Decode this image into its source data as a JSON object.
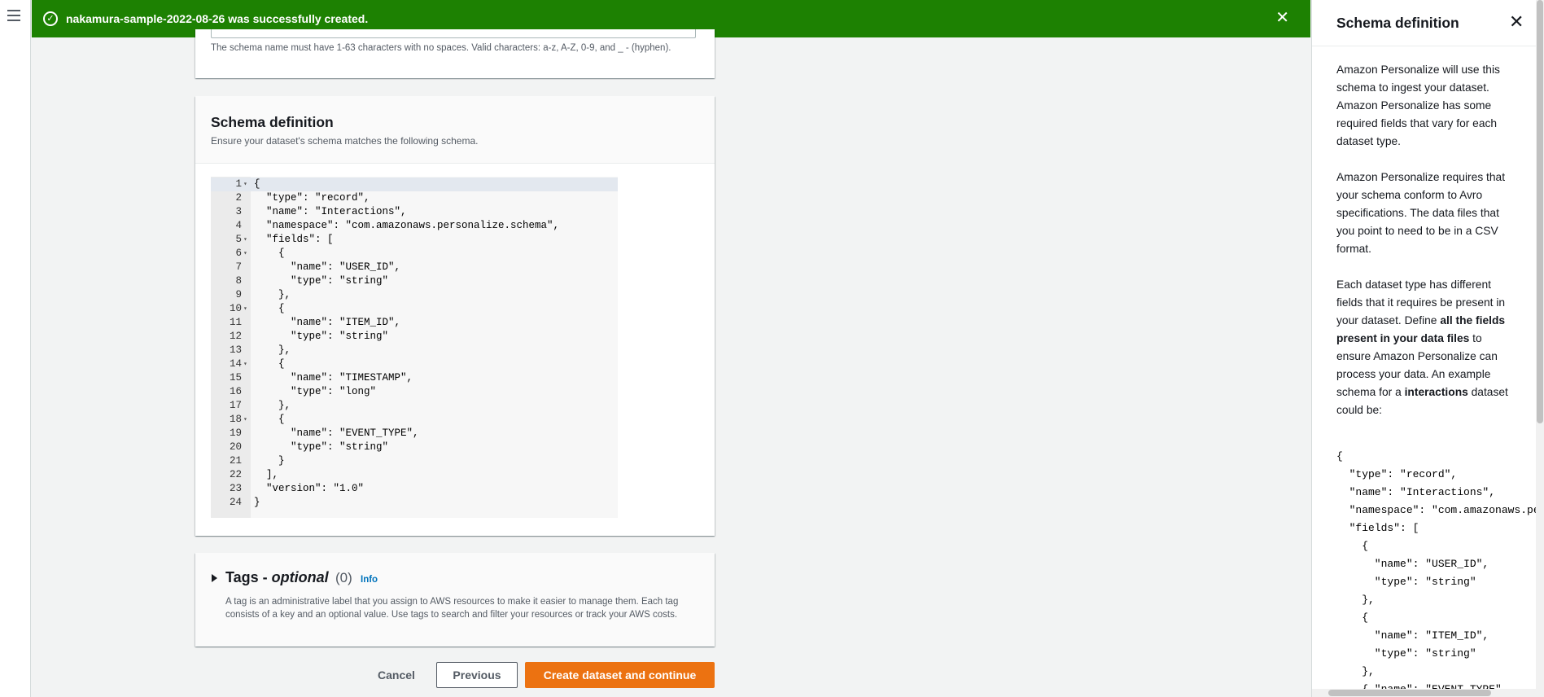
{
  "flash": {
    "message": "nakamura-sample-2022-08-26 was successfully created.",
    "color": "#1d8102"
  },
  "name_section": {
    "hint": "The schema name must have 1-63 characters with no spaces. Valid characters: a-z, A-Z, 0-9, and _ - (hyphen)."
  },
  "schema": {
    "title": "Schema definition",
    "description": "Ensure your dataset's schema matches the following schema.",
    "lines": [
      {
        "n": "1",
        "fold": true,
        "code": "{"
      },
      {
        "n": "2",
        "code": "  \"type\": \"record\","
      },
      {
        "n": "3",
        "code": "  \"name\": \"Interactions\","
      },
      {
        "n": "4",
        "code": "  \"namespace\": \"com.amazonaws.personalize.schema\","
      },
      {
        "n": "5",
        "fold": true,
        "code": "  \"fields\": ["
      },
      {
        "n": "6",
        "fold": true,
        "code": "    {"
      },
      {
        "n": "7",
        "code": "      \"name\": \"USER_ID\","
      },
      {
        "n": "8",
        "code": "      \"type\": \"string\""
      },
      {
        "n": "9",
        "code": "    },"
      },
      {
        "n": "10",
        "fold": true,
        "code": "    {"
      },
      {
        "n": "11",
        "code": "      \"name\": \"ITEM_ID\","
      },
      {
        "n": "12",
        "code": "      \"type\": \"string\""
      },
      {
        "n": "13",
        "code": "    },"
      },
      {
        "n": "14",
        "fold": true,
        "code": "    {"
      },
      {
        "n": "15",
        "code": "      \"name\": \"TIMESTAMP\","
      },
      {
        "n": "16",
        "code": "      \"type\": \"long\""
      },
      {
        "n": "17",
        "code": "    },"
      },
      {
        "n": "18",
        "fold": true,
        "code": "    {"
      },
      {
        "n": "19",
        "code": "      \"name\": \"EVENT_TYPE\","
      },
      {
        "n": "20",
        "code": "      \"type\": \"string\""
      },
      {
        "n": "21",
        "code": "    }"
      },
      {
        "n": "22",
        "code": "  ],"
      },
      {
        "n": "23",
        "code": "  \"version\": \"1.0\""
      },
      {
        "n": "24",
        "code": "}"
      }
    ]
  },
  "tags": {
    "title_prefix": "Tags - ",
    "title_optional": "optional",
    "count": "(0)",
    "info": "Info",
    "description": "A tag is an administrative label that you assign to AWS resources to make it easier to manage them. Each tag consists of a key and an optional value. Use tags to search and filter your resources or track your AWS costs."
  },
  "buttons": {
    "cancel": "Cancel",
    "previous": "Previous",
    "create": "Create dataset and continue",
    "primary_color": "#ec7211"
  },
  "help": {
    "title": "Schema definition",
    "p1": "Amazon Personalize will use this schema to ingest your dataset. Amazon Personalize has some required fields that vary for each dataset type.",
    "p2": "Amazon Personalize requires that your schema conform to Avro specifications. The data files that you point to need to be in a CSV format.",
    "p3_a": "Each dataset type has different fields that it requires be present in your dataset. Define ",
    "p3_b": "all the fields present in your data files",
    "p3_c": " to ensure Amazon Personalize can process your data. An example schema for a ",
    "p3_d": "interactions",
    "p3_e": " dataset could be:",
    "code": "{\n  \"type\": \"record\",\n  \"name\": \"Interactions\",\n  \"namespace\": \"com.amazonaws.personalize.schema\",\n  \"fields\": [\n    {\n      \"name\": \"USER_ID\",\n      \"type\": \"string\"\n    },\n    {\n      \"name\": \"ITEM_ID\",\n      \"type\": \"string\"\n    },\n    { \"name\": \"EVENT_TYPE\","
  },
  "icons": {
    "menu": "hamburger-icon",
    "success": "check-circle-icon",
    "close": "close-icon",
    "caret": "caret-right-icon"
  }
}
